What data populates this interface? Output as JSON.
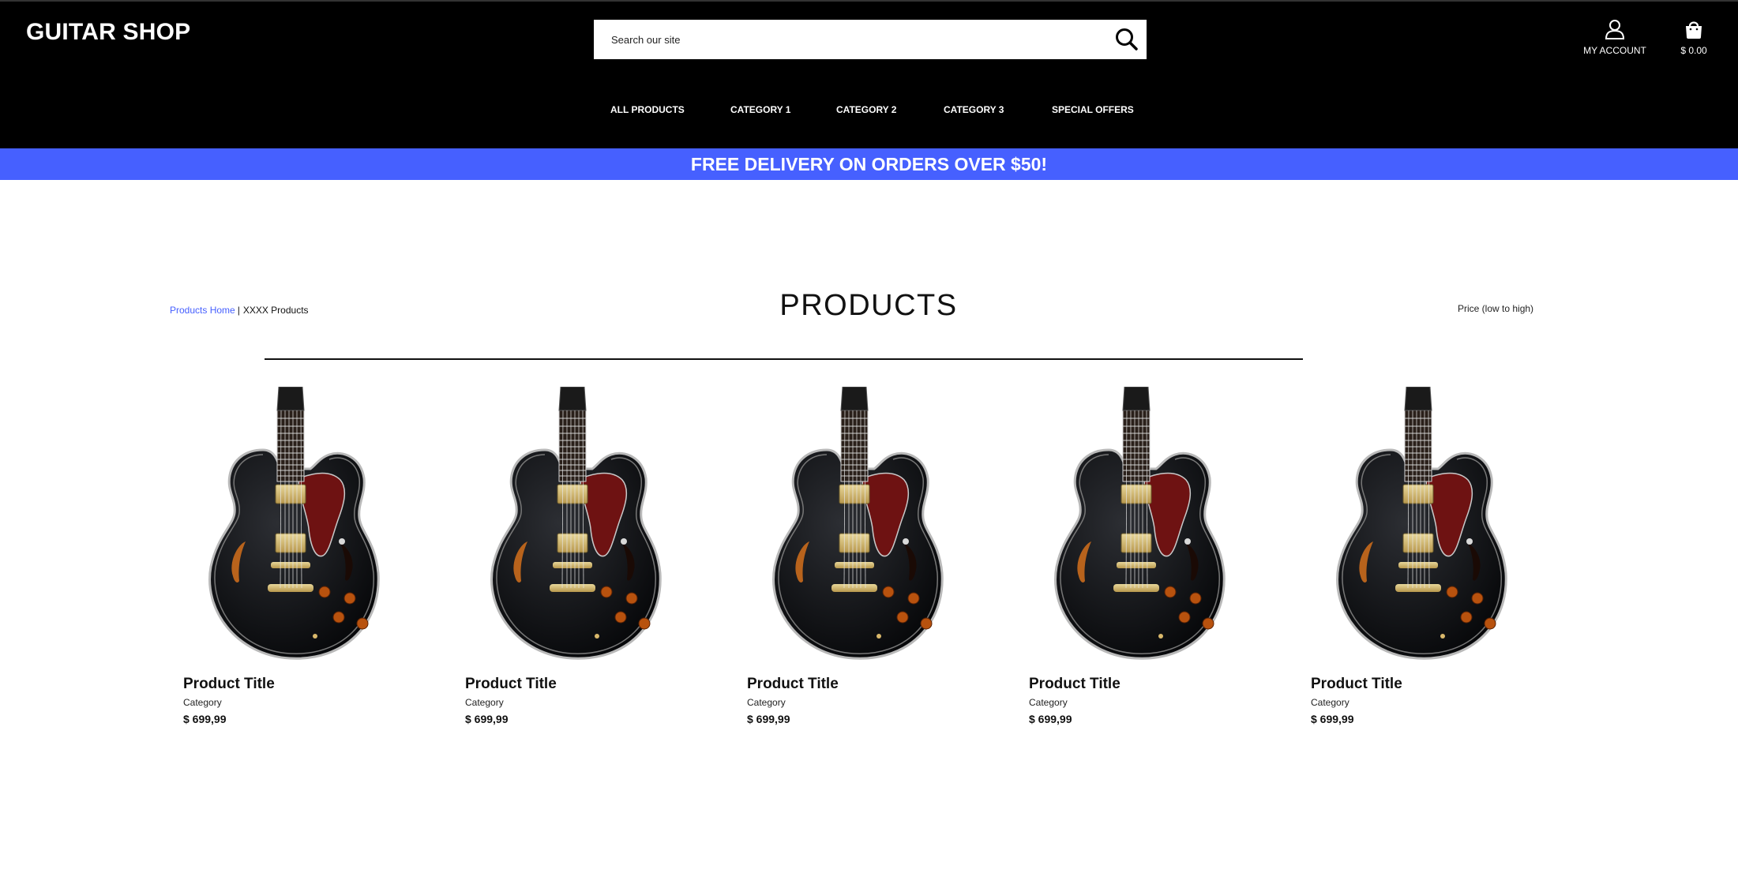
{
  "header": {
    "logo": "GUITAR SHOP",
    "search": {
      "placeholder": "Search our site",
      "icon": "search-icon"
    },
    "account": {
      "label": "MY ACCOUNT",
      "icon": "user-icon"
    },
    "cart": {
      "total": "$ 0.00",
      "icon": "shopping-bag-icon"
    },
    "nav": [
      {
        "label": "ALL PRODUCTS"
      },
      {
        "label": "CATEGORY 1"
      },
      {
        "label": "CATEGORY 2"
      },
      {
        "label": "CATEGORY 3"
      },
      {
        "label": "SPECIAL OFFERS"
      }
    ]
  },
  "promo": {
    "text": "FREE DELIVERY ON ORDERS OVER $50!",
    "color": "#4660ff"
  },
  "breadcrumb": {
    "home": "Products Home",
    "separator": "|",
    "current": "XXXX Products"
  },
  "page": {
    "title": "PRODUCTS",
    "sort": "Price (low to high)"
  },
  "products": [
    {
      "title": "Product Title",
      "category": "Category",
      "price": "$ 699,99",
      "image": "guitar-image"
    },
    {
      "title": "Product Title",
      "category": "Category",
      "price": "$ 699,99",
      "image": "guitar-image"
    },
    {
      "title": "Product Title",
      "category": "Category",
      "price": "$ 699,99",
      "image": "guitar-image"
    },
    {
      "title": "Product Title",
      "category": "Category",
      "price": "$ 699,99",
      "image": "guitar-image"
    },
    {
      "title": "Product Title",
      "category": "Category",
      "price": "$ 699,99",
      "image": "guitar-image"
    }
  ],
  "colors": {
    "header_bg": "#000000",
    "accent": "#4660ff",
    "text": "#111111"
  }
}
